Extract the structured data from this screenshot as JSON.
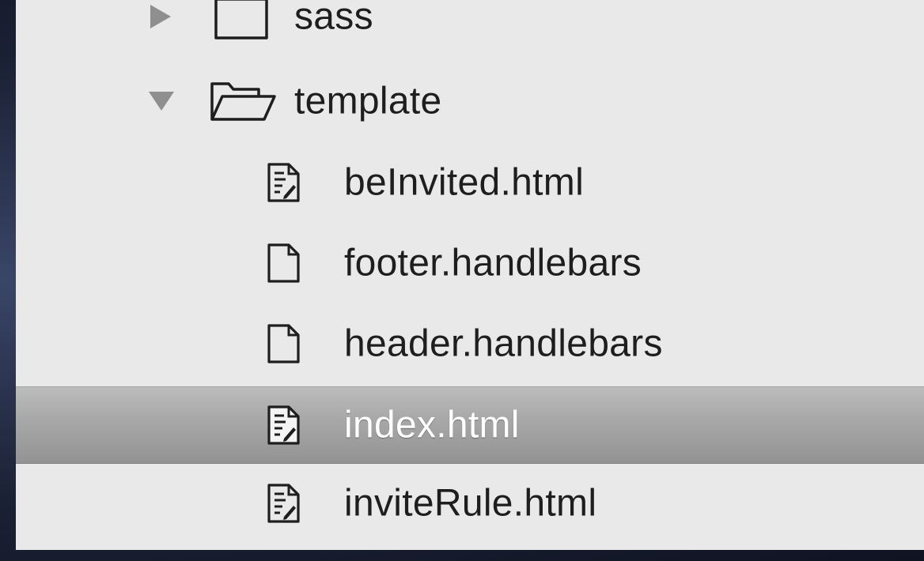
{
  "file_tree": {
    "items": [
      {
        "label": "sass",
        "type": "folder",
        "expanded": false,
        "icon": "folder-closed-icon"
      },
      {
        "label": "template",
        "type": "folder",
        "expanded": true,
        "icon": "folder-open-icon"
      },
      {
        "label": "beInvited.html",
        "type": "file",
        "icon": "html-file-icon"
      },
      {
        "label": "footer.handlebars",
        "type": "file",
        "icon": "plain-file-icon"
      },
      {
        "label": "header.handlebars",
        "type": "file",
        "icon": "plain-file-icon"
      },
      {
        "label": "index.html",
        "type": "file",
        "icon": "html-file-icon",
        "selected": true
      },
      {
        "label": "inviteRule.html",
        "type": "file",
        "icon": "html-file-icon"
      }
    ]
  },
  "colors": {
    "panel_background": "#e9e9e9",
    "selection_highlight": "#a9a9a9",
    "text": "#1e1e1e",
    "selected_text": "#ffffff",
    "desktop_background": "#1c2236"
  }
}
